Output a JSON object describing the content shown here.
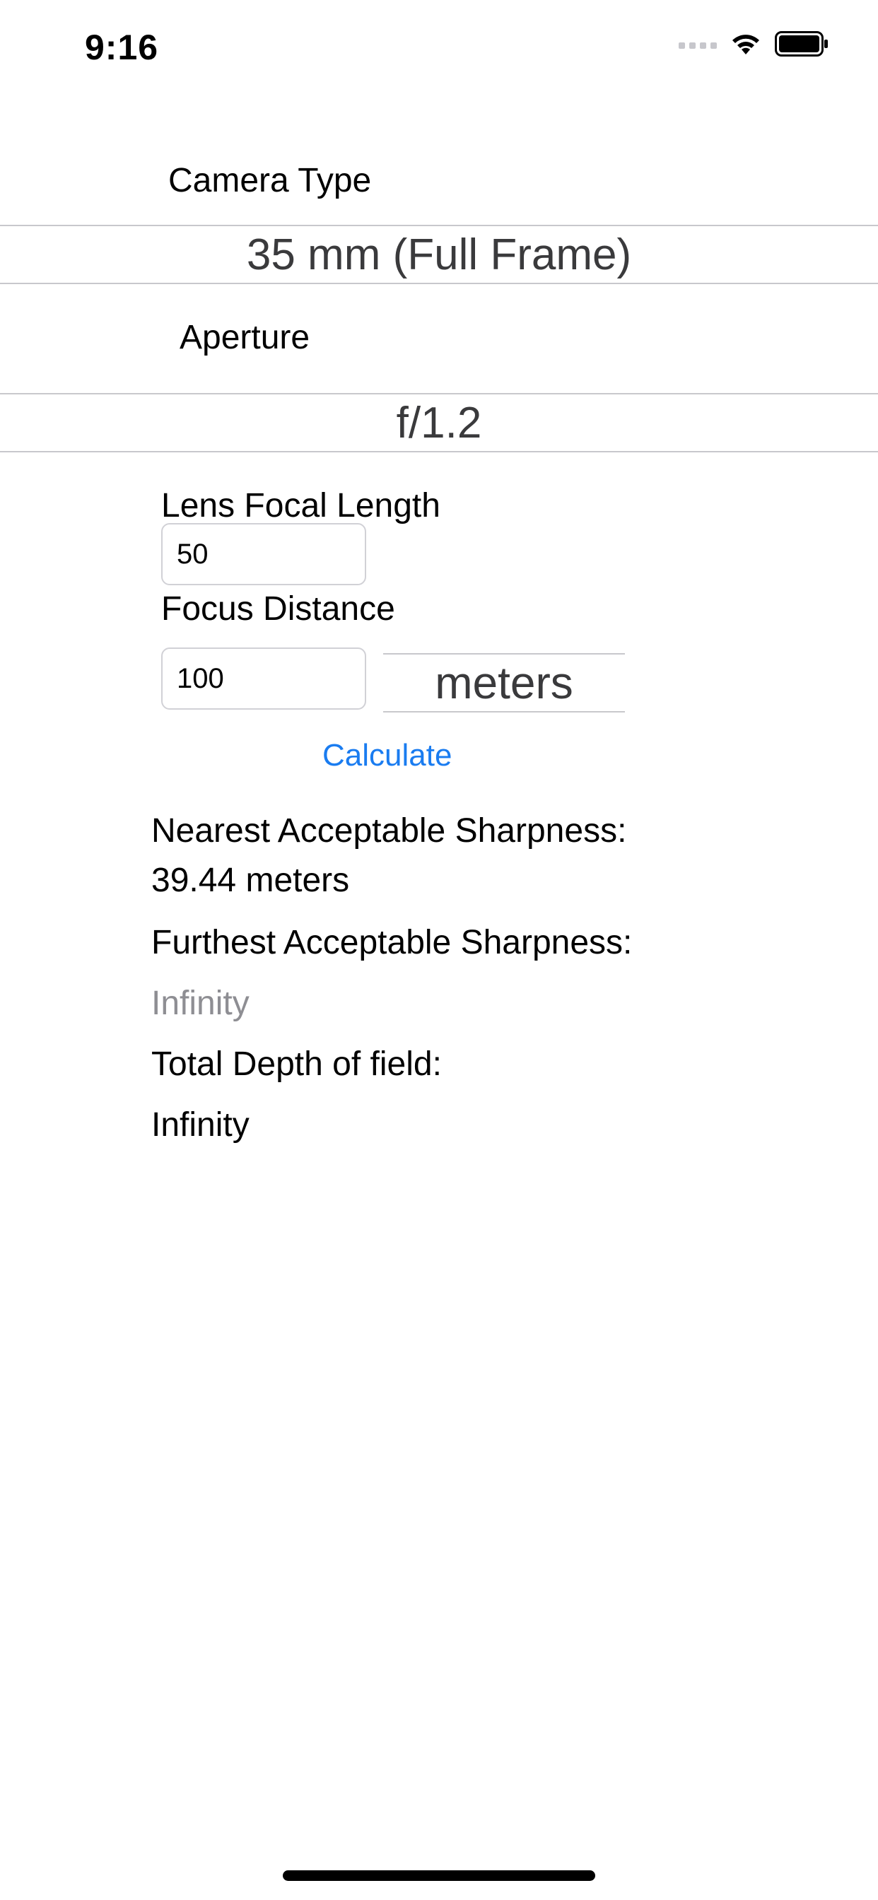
{
  "status_bar": {
    "time": "9:16",
    "icons": [
      "cellular-signal-icon",
      "wifi-icon",
      "battery-icon"
    ]
  },
  "form": {
    "camera_type_label": "Camera Type",
    "camera_type_value": "35 mm (Full Frame)",
    "aperture_label": "Aperture",
    "aperture_value": "f/1.2",
    "focal_length_label": "Lens Focal Length",
    "focal_length_value": "50",
    "focus_distance_label": "Focus Distance",
    "focus_distance_value": "100",
    "unit_value": "meters",
    "calculate_label": "Calculate"
  },
  "results": {
    "nearest_label": "Nearest Acceptable Sharpness:",
    "nearest_value": "39.44 meters",
    "furthest_label": "Furthest Acceptable Sharpness:",
    "furthest_value": "Infinity",
    "total_label": "Total Depth of field:",
    "total_value": "Infinity"
  },
  "colors": {
    "accent": "#1a7cf0",
    "muted_text": "#8e8e93",
    "separator": "#c8c8cc"
  }
}
